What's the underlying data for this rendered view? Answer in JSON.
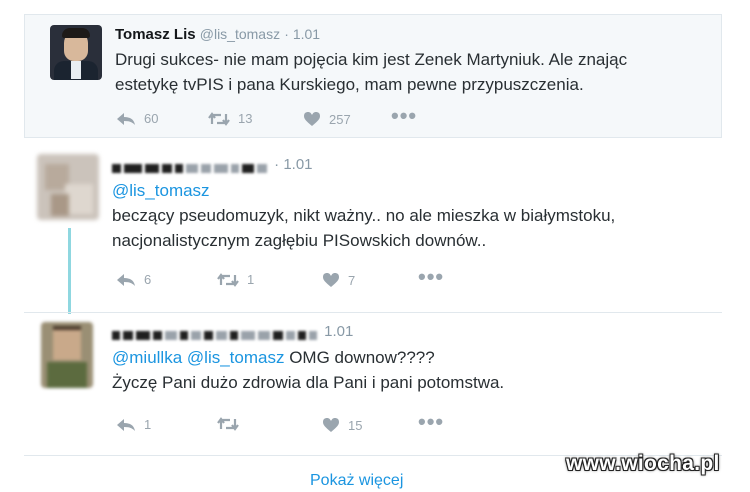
{
  "main_tweet": {
    "author_name": "Tomasz Lis",
    "handle": "@lis_tomasz",
    "time": "· 1.01",
    "line1": "Drugi sukces- nie mam pojęcia kim jest Zenek Martyniuk. Ale znając",
    "line2": "estetykę tvPIS i pana Kurskiego, mam pewne przypuszczenia.",
    "reply_count": "60",
    "retweet_count": "13",
    "like_count": "257"
  },
  "reply1": {
    "time": "· 1.01",
    "mention": "@lis_tomasz",
    "line1": "beczący pseudomuzyk, nikt ważny.. no ale mieszka w białymstoku,",
    "line2": "nacjonalistycznym zagłębiu PISowskich downów..",
    "reply_count": "6",
    "retweet_count": "1",
    "like_count": "7"
  },
  "reply2": {
    "time": "1.01",
    "mention1": "@miullka",
    "mention2": "@lis_tomasz",
    "text_tail": " OMG downow????",
    "line2": "Życzę Pani dużo zdrowia dla Pani i pani potomstwa.",
    "reply_count": "1",
    "retweet_count": "",
    "like_count": "15"
  },
  "show_more": "Pokaż więcej",
  "watermark": "www.wiocha.pl",
  "colors": {
    "accent": "#1b95e0",
    "muted": "#8899a6",
    "thread_line": "#8fd7e0",
    "main_bg": "#f5f8fa"
  },
  "icons": [
    "reply-icon",
    "retweet-icon",
    "like-icon",
    "more-icon"
  ]
}
